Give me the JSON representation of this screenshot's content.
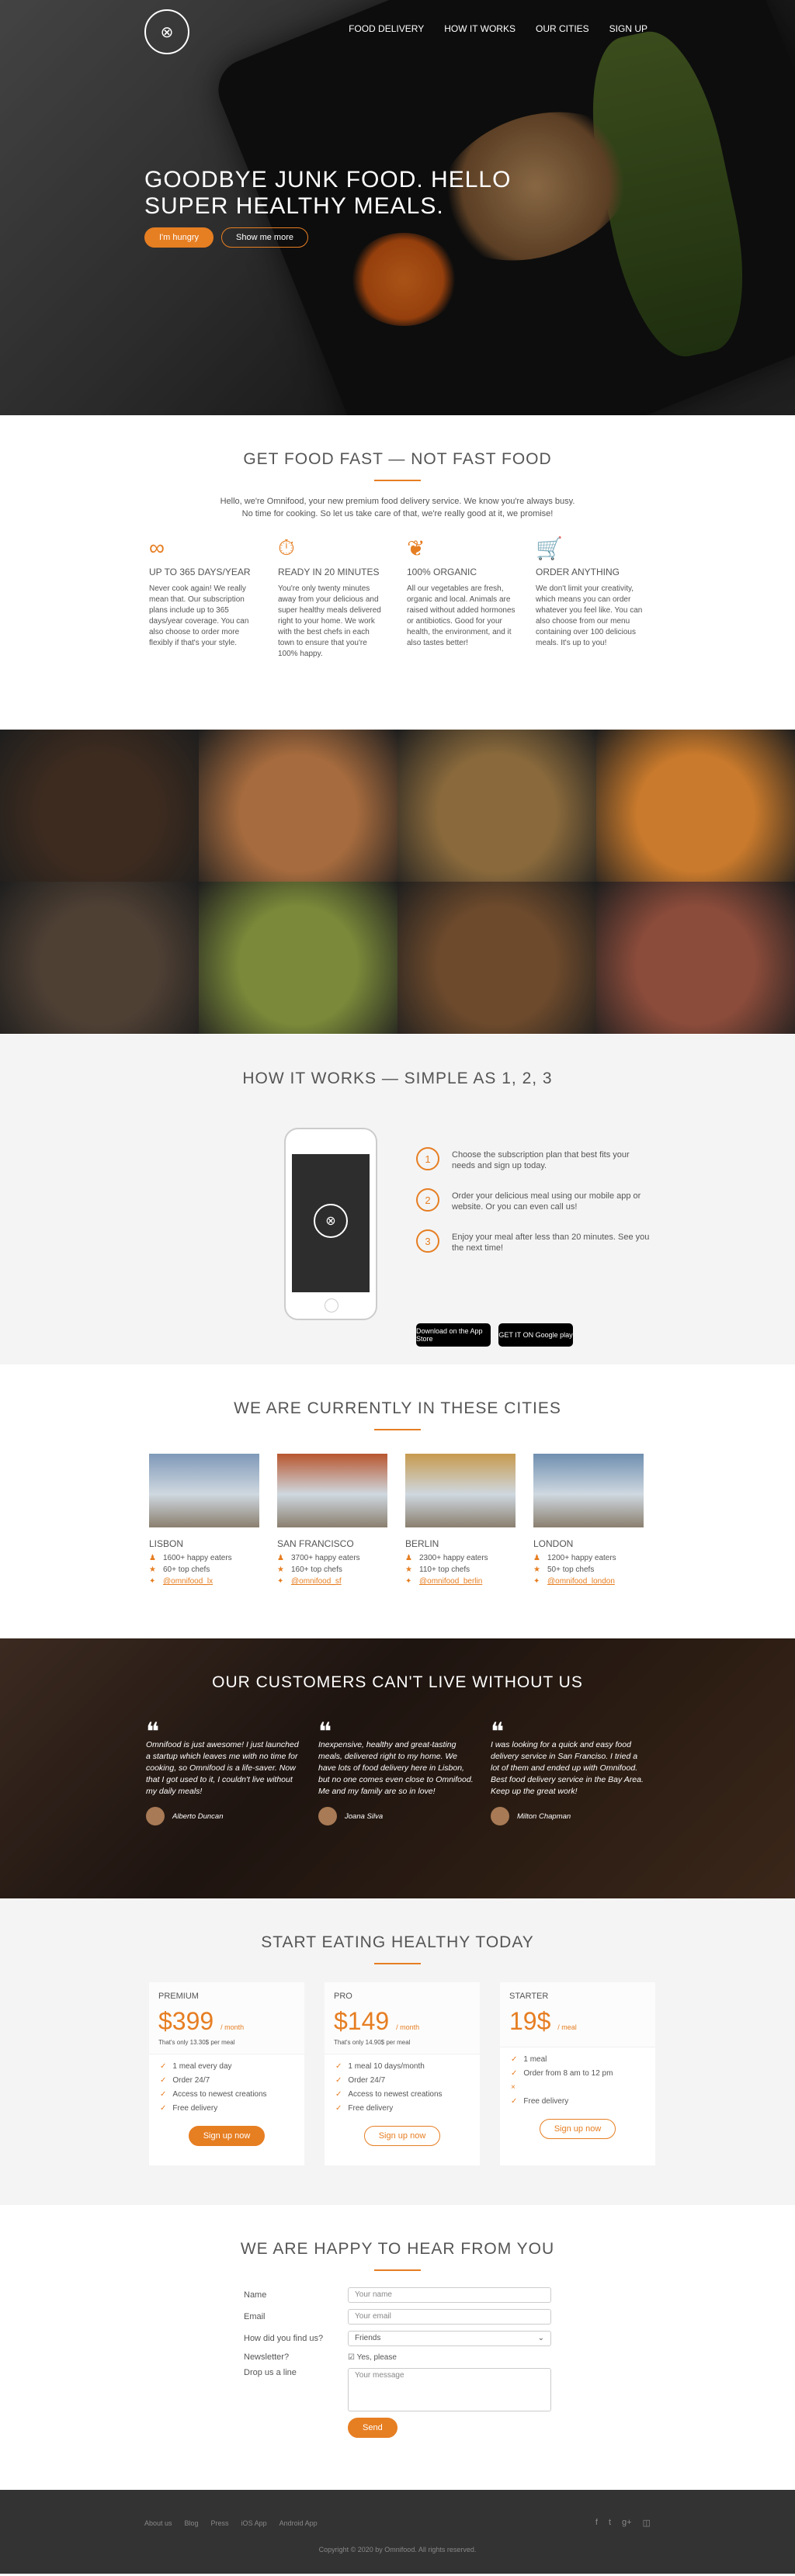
{
  "nav": {
    "logo": "⊗",
    "items": [
      "Food delivery",
      "How it works",
      "Our cities",
      "Sign up"
    ]
  },
  "hero": {
    "title": "Goodbye junk food. Hello super healthy meals.",
    "btn_primary": "I'm hungry",
    "btn_secondary": "Show me more"
  },
  "features": {
    "title": "Get food fast — not fast food",
    "intro": "Hello, we're Omnifood, your new premium food delivery service. We know you're always busy. No time for cooking. So let us take care of that, we're really good at it, we promise!",
    "items": [
      {
        "icon": "infinity-icon",
        "title": "Up to 365 days/year",
        "text": "Never cook again! We really mean that. Our subscription plans include up to 365 days/year coverage. You can also choose to order more flexibly if that's your style."
      },
      {
        "icon": "stopwatch-icon",
        "title": "Ready in 20 minutes",
        "text": "You're only twenty minutes away from your delicious and super healthy meals delivered right to your home. We work with the best chefs in each town to ensure that you're 100% happy."
      },
      {
        "icon": "leaf-icon",
        "title": "100% organic",
        "text": "All our vegetables are fresh, organic and local. Animals are raised without added hormones or antibiotics. Good for your health, the environment, and it also tastes better!"
      },
      {
        "icon": "cart-icon",
        "title": "Order anything",
        "text": "We don't limit your creativity, which means you can order whatever you feel like. You can also choose from our menu containing over 100 delicious meals. It's up to you!"
      }
    ]
  },
  "meals": {
    "colors": [
      "#3d2b1f",
      "#a66b3e",
      "#8a6a3c",
      "#c97a2c",
      "#4f4034",
      "#7b8a3a",
      "#6d4a2c",
      "#8c4c3b"
    ]
  },
  "how": {
    "title": "How it works — Simple as 1, 2, 3",
    "steps": [
      {
        "num": "1",
        "text": "Choose the subscription plan that best fits your needs and sign up today."
      },
      {
        "num": "2",
        "text": "Order your delicious meal using our mobile app or website. Or you can even call us!"
      },
      {
        "num": "3",
        "text": "Enjoy your meal after less than 20 minutes. See you the next time!"
      }
    ],
    "appstore": "Download on the App Store",
    "googleplay": "GET IT ON Google play"
  },
  "cities": {
    "title": "We are currently in these cities",
    "items": [
      {
        "name": "Lisbon",
        "eaters": "1600+ happy eaters",
        "chefs": "60+ top chefs",
        "twitter": "@omnifood_lx",
        "color": "#7f99b8"
      },
      {
        "name": "San Francisco",
        "eaters": "3700+ happy eaters",
        "chefs": "160+ top chefs",
        "twitter": "@omnifood_sf",
        "color": "#b8562e"
      },
      {
        "name": "Berlin",
        "eaters": "2300+ happy eaters",
        "chefs": "110+ top chefs",
        "twitter": "@omnifood_berlin",
        "color": "#c79a4e"
      },
      {
        "name": "London",
        "eaters": "1200+ happy eaters",
        "chefs": "50+ top chefs",
        "twitter": "@omnifood_london",
        "color": "#6f8fb0"
      }
    ]
  },
  "testimonials": {
    "title": "Our customers can't live without us",
    "items": [
      {
        "text": "Omnifood is just awesome! I just launched a startup which leaves me with no time for cooking, so Omnifood is a life-saver. Now that I got used to it, I couldn't live without my daily meals!",
        "author": "Alberto Duncan"
      },
      {
        "text": "Inexpensive, healthy and great-tasting meals, delivered right to my home. We have lots of food delivery here in Lisbon, but no one comes even close to Omnifood. Me and my family are so in love!",
        "author": "Joana Silva"
      },
      {
        "text": "I was looking for a quick and easy food delivery service in San Franciso. I tried a lot of them and ended up with Omnifood. Best food delivery service in the Bay Area. Keep up the great work!",
        "author": "Milton Chapman"
      }
    ]
  },
  "plans": {
    "title": "Start eating healthy today",
    "items": [
      {
        "name": "Premium",
        "price": "$399",
        "period": "/ month",
        "per": "That's only 13.30$ per meal",
        "features": [
          "1 meal every day",
          "Order 24/7",
          "Access to newest creations",
          "Free delivery"
        ],
        "button": "Sign up now",
        "style": "full"
      },
      {
        "name": "Pro",
        "price": "$149",
        "period": "/ month",
        "per": "That's only 14.90$ per meal",
        "features": [
          "1 meal 10 days/month",
          "Order 24/7",
          "Access to newest creations",
          "Free delivery"
        ],
        "button": "Sign up now",
        "style": "ghost"
      },
      {
        "name": "Starter",
        "price": "19$",
        "period": "/ meal",
        "per": "",
        "features": [
          "1 meal",
          "Order from 8 am to 12 pm",
          "",
          "Free delivery"
        ],
        "button": "Sign up now",
        "style": "ghost"
      }
    ]
  },
  "contact": {
    "title": "We are happy to hear from you",
    "labels": {
      "name": "Name",
      "email": "Email",
      "find": "How did you find us?",
      "newsletter": "Newsletter?",
      "message": "Drop us a line"
    },
    "placeholders": {
      "name": "Your name",
      "email": "Your email",
      "message": "Your message"
    },
    "find_value": "Friends",
    "newsletter_value": "Yes, please",
    "send": "Send"
  },
  "footer": {
    "links": [
      "About us",
      "Blog",
      "Press",
      "iOS App",
      "Android App"
    ],
    "social": [
      "f",
      "t",
      "g+",
      "◫"
    ],
    "copyright": "Copyright © 2020 by Omnifood. All rights reserved."
  }
}
